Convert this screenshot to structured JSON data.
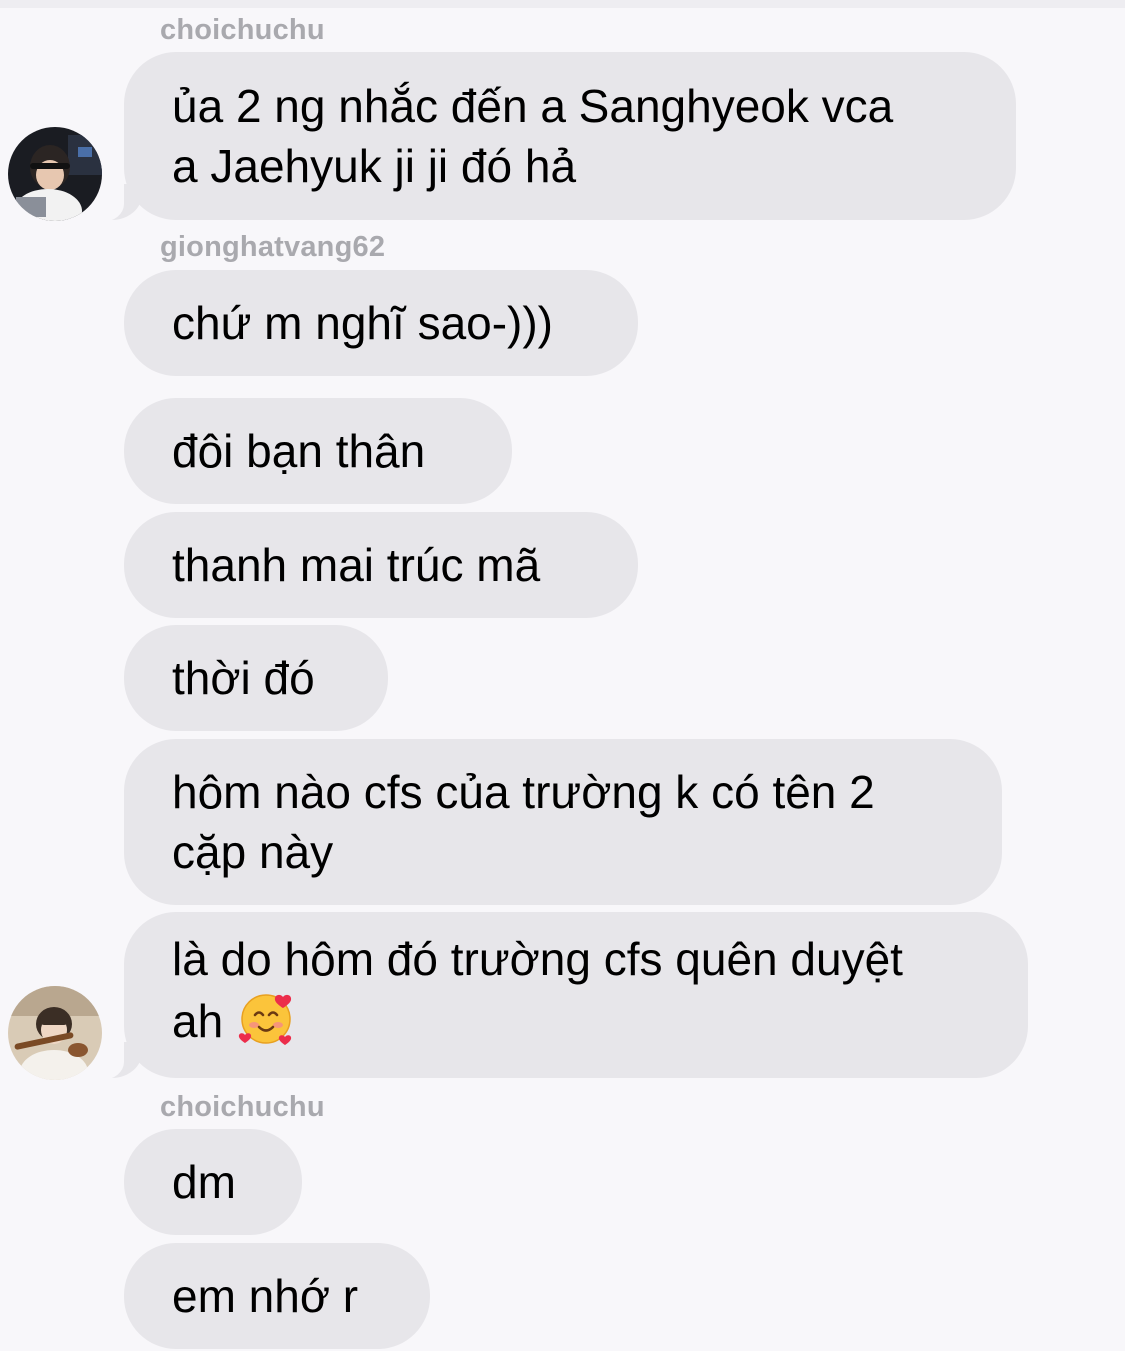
{
  "conversation": {
    "groups": [
      {
        "sender": "choichuchu",
        "avatar_icon": "headset-gamer-avatar-icon",
        "messages": [
          {
            "lines": [
              "ủa 2 ng nhắc đến a Sanghyeok vca",
              "a Jaehyuk ji ji đó hả"
            ]
          }
        ]
      },
      {
        "sender": "gionghatvang62",
        "avatar_icon": "young-man-violin-avatar-icon",
        "messages": [
          {
            "lines": [
              "chứ m nghĩ sao-)))"
            ]
          },
          {
            "lines": [
              "đôi bạn thân"
            ]
          },
          {
            "lines": [
              "thanh mai trúc mã"
            ]
          },
          {
            "lines": [
              "thời đó"
            ]
          },
          {
            "lines": [
              "hôm nào cfs của trường k có tên 2",
              "cặp này"
            ]
          },
          {
            "lines": [
              "là do hôm đó trường cfs quên duyệt",
              "ah"
            ],
            "emoji": "smiling-face-with-hearts-icon"
          }
        ]
      },
      {
        "sender": "choichuchu",
        "messages": [
          {
            "lines": [
              "dm"
            ]
          },
          {
            "lines": [
              "em nhớ r"
            ]
          }
        ]
      }
    ]
  },
  "colors": {
    "background": "#f8f7fa",
    "bubble": "#e7e6ea",
    "sender_name": "#a9a9ae",
    "message_text": "#000000"
  }
}
